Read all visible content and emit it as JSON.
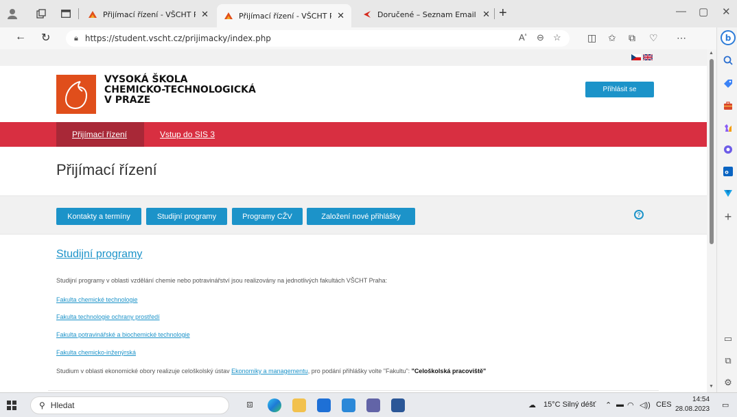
{
  "browser": {
    "tabs": [
      {
        "title": "Přijímací řízení - VŠCHT Praha",
        "active": false
      },
      {
        "title": "Přijímací řízení - VŠCHT Praha",
        "active": true
      },
      {
        "title": "Doručené – Seznam Email",
        "active": false
      }
    ],
    "new_tab": "+",
    "url": "https://student.vscht.cz/prijimacky/index.php"
  },
  "page": {
    "logo_lines": [
      "VYSOKÁ ŠKOLA",
      "CHEMICKO-TECHNOLOGICKÁ",
      "V PRAZE"
    ],
    "login_label": "Přihlásit se",
    "nav": [
      {
        "label": "Přijímací řízení",
        "active": true
      },
      {
        "label": "Vstup do SIS 3",
        "active": false
      }
    ],
    "title": "Přijímací řízení",
    "buttons": [
      "Kontakty a termíny",
      "Studijní programy",
      "Programy CŽV",
      "Založení nové přihlášky"
    ],
    "help_symbol": "?",
    "section_title": "Studijní programy",
    "intro": "Studijní programy v oblasti vzdělání chemie nebo potravinářství jsou realizovány na jednotlivých fakultách VŠCHT Praha:",
    "faculties": [
      "Fakulta chemické technologie",
      "Fakulta technologie ochrany prostředí",
      "Fakulta potravinářské a biochemické technologie",
      "Fakulta chemicko-inženýrská"
    ],
    "note_before": "Studium v oblasti ekonomické obory realizuje celoškolský ústav ",
    "note_link": "Ekonomiky a managementu",
    "note_after": ", pro podání přihlášky volte \"Fakultu\": ",
    "note_bold": "\"Celoškolská pracoviště\""
  },
  "taskbar": {
    "search_placeholder": "Hledat",
    "weather": "15°C  Silný déšť",
    "language": "CES",
    "time": "14:54",
    "date": "28.08.2023"
  },
  "colors": {
    "accent_blue": "#1c93c9",
    "red_bar": "#d82f41",
    "red_bar_active": "#a82837",
    "logo_orange": "#e04e1b"
  }
}
